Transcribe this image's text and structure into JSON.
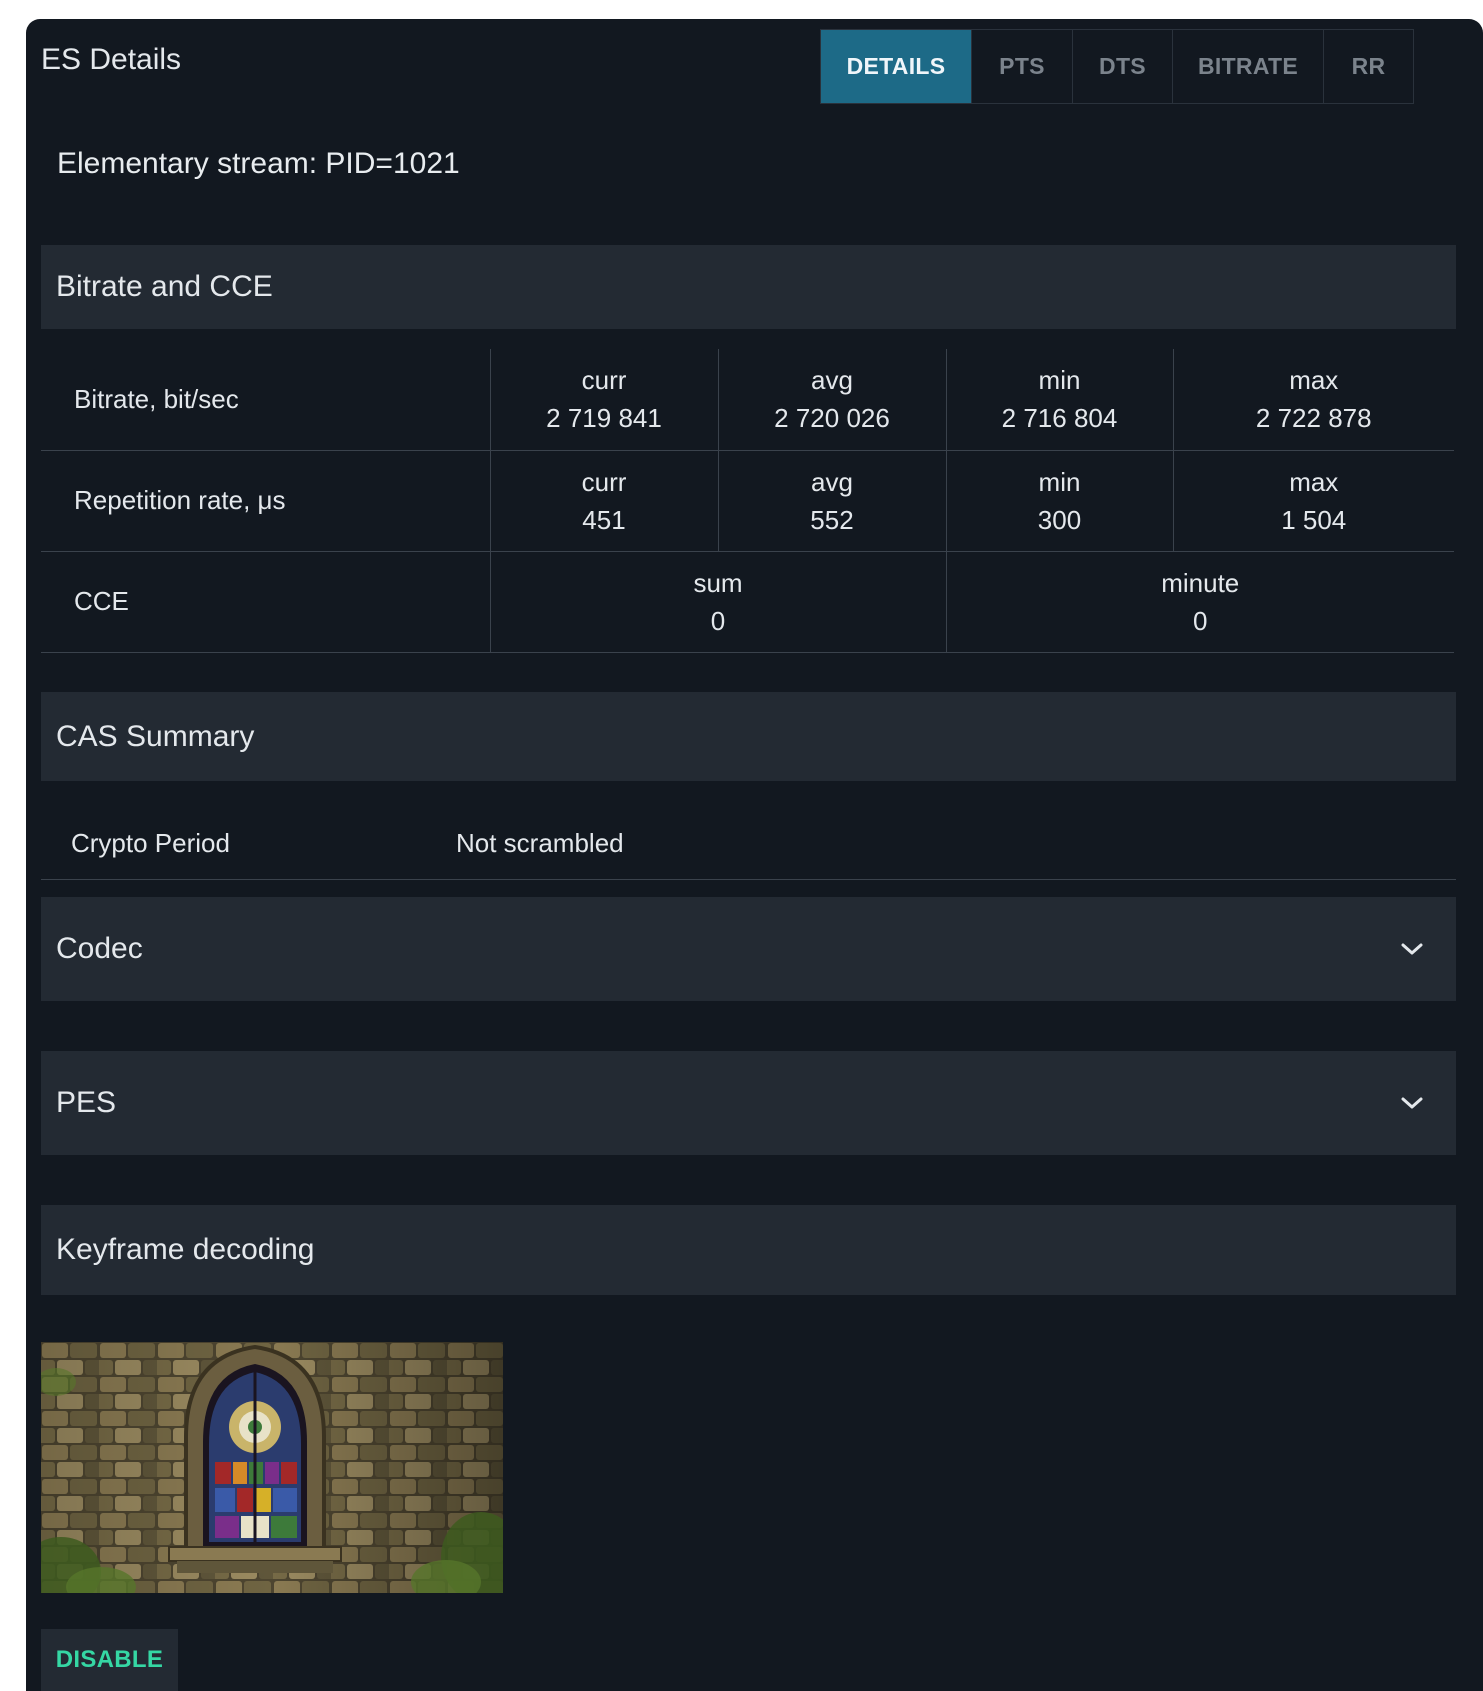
{
  "panel": {
    "title": "ES Details"
  },
  "tabs": [
    {
      "label": "DETAILS",
      "active": true
    },
    {
      "label": "PTS",
      "active": false
    },
    {
      "label": "DTS",
      "active": false
    },
    {
      "label": "BITRATE",
      "active": false
    },
    {
      "label": "RR",
      "active": false
    }
  ],
  "stream": {
    "title": "Elementary stream: PID=1021"
  },
  "sections": {
    "bitrate_cce": "Bitrate and CCE",
    "cas_summary": "CAS Summary",
    "codec": "Codec",
    "pes": "PES",
    "keyframe": "Keyframe decoding"
  },
  "stats": {
    "bitrate": {
      "label": "Bitrate, bit/sec",
      "cells": [
        {
          "name": "curr",
          "value": "2 719 841"
        },
        {
          "name": "avg",
          "value": "2 720 026"
        },
        {
          "name": "min",
          "value": "2 716 804"
        },
        {
          "name": "max",
          "value": "2 722 878"
        }
      ]
    },
    "repetition": {
      "label": "Repetition rate, μs",
      "cells": [
        {
          "name": "curr",
          "value": "451"
        },
        {
          "name": "avg",
          "value": "552"
        },
        {
          "name": "min",
          "value": "300"
        },
        {
          "name": "max",
          "value": "1 504"
        }
      ]
    },
    "cce": {
      "label": "CCE",
      "cells": [
        {
          "name": "sum",
          "value": "0"
        },
        {
          "name": "minute",
          "value": "0"
        }
      ]
    }
  },
  "cas": {
    "key": "Crypto Period",
    "value": "Not scrambled"
  },
  "buttons": {
    "disable": "DISABLE"
  },
  "colors": {
    "panel_bg": "#121820",
    "section_bg": "#232a33",
    "tab_active": "#1d6a87",
    "accent_green": "#35d7a4"
  }
}
